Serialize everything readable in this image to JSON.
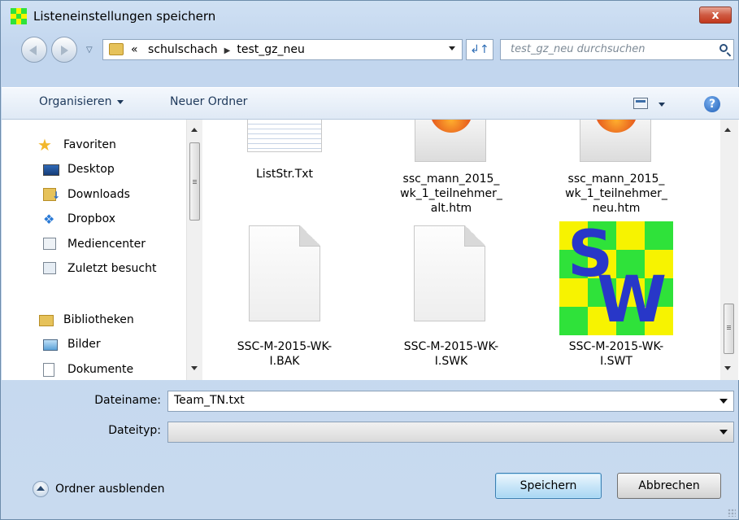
{
  "window": {
    "title": "Listeneinstellungen speichern",
    "close_label": "x"
  },
  "navigation": {
    "path": [
      "«",
      "schulschach",
      "test_gz_neu"
    ],
    "search_placeholder": "test_gz_neu durchsuchen"
  },
  "toolbar": {
    "organize_label": "Organisieren",
    "new_folder_label": "Neuer Ordner",
    "help_label": "?"
  },
  "sidebar": {
    "favorites_label": "Favoriten",
    "favorites": [
      "Desktop",
      "Downloads",
      "Dropbox",
      "Mediencenter",
      "Zuletzt besucht"
    ],
    "libraries_label": "Bibliotheken",
    "libraries": [
      "Bilder",
      "Dokumente"
    ]
  },
  "files": [
    {
      "name": "ListStr.Txt",
      "icon": "text-file-icon"
    },
    {
      "name": "ssc_mann_2015_\nwk_1_teilnehmer_\nalt.htm",
      "line1": "ssc_mann_2015_",
      "line2": "wk_1_teilnehmer_",
      "line3": "alt.htm",
      "icon": "firefox-icon"
    },
    {
      "name": "ssc_mann_2015_\nwk_1_teilnehmer_\nneu.htm",
      "line1": "ssc_mann_2015_",
      "line2": "wk_1_teilnehmer_",
      "line3": "neu.htm",
      "icon": "firefox-icon"
    },
    {
      "line1": "SSC-M-2015-WK-",
      "line2": "I.BAK",
      "icon": "blank-file-icon"
    },
    {
      "line1": "SSC-M-2015-WK-",
      "line2": "I.SWK",
      "icon": "blank-file-icon"
    },
    {
      "line1": "SSC-M-2015-WK-",
      "line2": "I.SWT",
      "icon": "swiss-chess-icon"
    }
  ],
  "form": {
    "filename_label": "Dateiname:",
    "filename_value": "Team_TN.txt",
    "filetype_label": "Dateityp:",
    "filetype_value": ""
  },
  "footer": {
    "hide_folders_label": "Ordner ausblenden",
    "save_label": "Speichern",
    "cancel_label": "Abbrechen"
  },
  "colors": {
    "close_red": "#c2381d",
    "sw_yellow": "#f7f300",
    "sw_green": "#2fe23a",
    "sw_blue": "#2837c8"
  }
}
